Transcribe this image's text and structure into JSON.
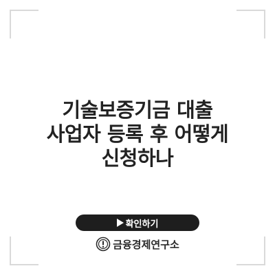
{
  "title_lines": [
    "기술보증기금 대출",
    "사업자 등록 후 어떻게",
    "신청하나"
  ],
  "button": {
    "label": "확인하기",
    "icon": "play-icon"
  },
  "brand": {
    "name": "금융경제연구소",
    "icon": "exclamation-badge-icon"
  },
  "colors": {
    "background": "#ffffff",
    "button": "#1e1e1e",
    "text": "#222222",
    "corners": "#d9d9d9"
  }
}
